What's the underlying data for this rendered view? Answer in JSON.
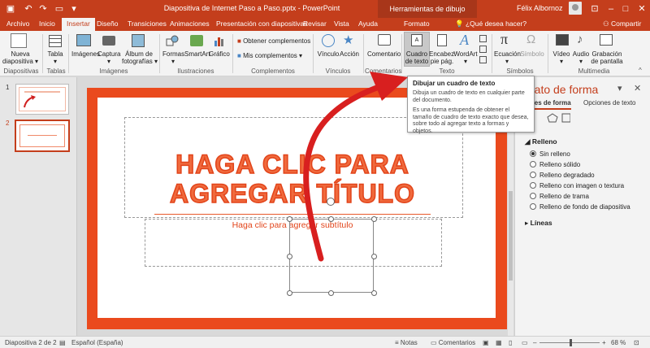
{
  "titlebar": {
    "title": "Diapositiva de Internet Paso a Paso.pptx  -  PowerPoint",
    "contextual": "Herramientas de dibujo",
    "user": "Félix Albornoz"
  },
  "tabs": [
    "Archivo",
    "Inicio",
    "Insertar",
    "Diseño",
    "Transiciones",
    "Animaciones",
    "Presentación con diapositivas",
    "Revisar",
    "Vista",
    "Ayuda",
    "Formato"
  ],
  "tell_me": "¿Qué desea hacer?",
  "share": "Compartir",
  "ribbon": {
    "new_slide": [
      "Nueva",
      "diapositiva ▾"
    ],
    "table": [
      "Tabla",
      "▾"
    ],
    "images": [
      "Imágenes"
    ],
    "capture": [
      "Captura",
      "▾"
    ],
    "album": [
      "Álbum de",
      "fotografías ▾"
    ],
    "shapes": [
      "Formas",
      "▾"
    ],
    "smartart": "SmartArt",
    "chart": "Gráfico",
    "get_addins": "Obtener complementos",
    "my_addins": "Mis complementos",
    "link": "Vínculo",
    "action": "Acción",
    "comment": "Comentario",
    "textbox": [
      "Cuadro",
      "de texto"
    ],
    "header": [
      "Encabez.",
      "pie pág."
    ],
    "wordart": [
      "WordArt",
      "▾"
    ],
    "equation": [
      "Ecuación",
      "▾"
    ],
    "symbol": "Símbolo",
    "video": [
      "Vídeo",
      "▾"
    ],
    "audio": [
      "Audio",
      "▾"
    ],
    "recording": [
      "Grabación",
      "de pantalla"
    ],
    "groups": [
      "Diapositivas",
      "Tablas",
      "Imágenes",
      "Ilustraciones",
      "Complementos",
      "Vínculos",
      "Comentarios",
      "Texto",
      "Símbolos",
      "Multimedia"
    ]
  },
  "tooltip": {
    "title": "Dibujar un cuadro de texto",
    "line1": "Dibuja un cuadro de texto en cualquier parte del documento.",
    "line2": "Es una forma estupenda de obtener el tamaño de cuadro de texto exacto que desea, sobre todo al agregar texto a formas y objetos."
  },
  "thumbnails": [
    "1",
    "2"
  ],
  "slide": {
    "title_line1": "HAGA CLIC PARA",
    "title_line2": "AGREGAR TÍTULO",
    "subtitle": "Haga clic para agregar subtítulo"
  },
  "format_pane": {
    "title": "mato de forma",
    "tab1": "ones de forma",
    "tab2": "Opciones de texto",
    "section_fill": "Relleno",
    "options": [
      "Sin relleno",
      "Relleno sólido",
      "Relleno degradado",
      "Relleno con imagen o textura",
      "Relleno de trama",
      "Relleno de fondo de diapositiva"
    ],
    "section_lines": "Líneas"
  },
  "status": {
    "slide_info": "Diapositiva 2 de 2",
    "language": "Español (España)",
    "notes": "Notas",
    "comments": "Comentarios",
    "zoom": "68 %"
  },
  "colors": {
    "accent": "#c43e1c",
    "slide_border": "#ea4a1d",
    "title_text": "#f06a3d"
  }
}
